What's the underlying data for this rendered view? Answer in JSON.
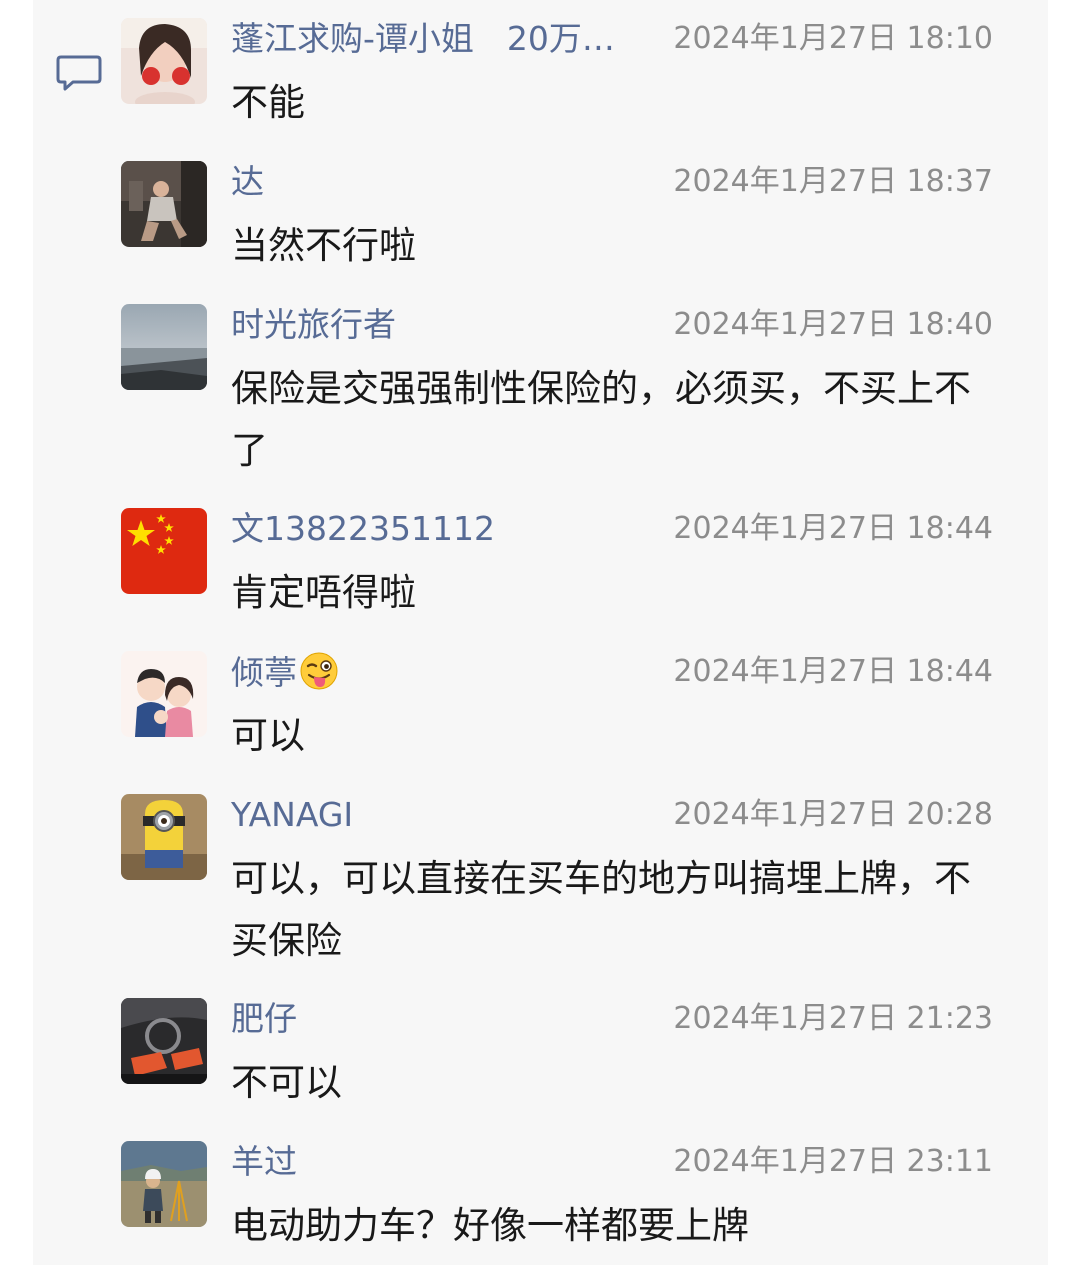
{
  "comments": [
    {
      "name": "蓬江求购-谭小姐　20万…",
      "time": "2024年1月27日 18:10",
      "text": "不能",
      "avatar_icon": "photo-avatar"
    },
    {
      "name": "达",
      "time": "2024年1月27日 18:37",
      "text": "当然不行啦",
      "avatar_icon": "photo-avatar"
    },
    {
      "name": "时光旅行者",
      "time": "2024年1月27日 18:40",
      "text": "保险是交强强制性保险的，必须买，不买上不了",
      "avatar_icon": "landscape-avatar"
    },
    {
      "name": "文13822351112",
      "time": "2024年1月27日 18:44",
      "text": "肯定唔得啦",
      "avatar_icon": "flag-avatar"
    },
    {
      "name": "倾葶",
      "time": "2024年1月27日 18:44",
      "text": "可以",
      "avatar_icon": "cartoon-avatar",
      "emoji": "winking-tongue-emoji"
    },
    {
      "name": "YANAGI",
      "time": "2024年1月27日 20:28",
      "text": "可以，可以直接在买车的地方叫搞埋上牌，不买保险",
      "avatar_icon": "minion-avatar"
    },
    {
      "name": "肥仔",
      "time": "2024年1月27日 21:23",
      "text": "不可以",
      "avatar_icon": "car-interior-avatar"
    },
    {
      "name": "羊过",
      "time": "2024年1月27日 23:11",
      "text": "电动助力车？好像一样都要上牌",
      "avatar_icon": "worker-avatar"
    }
  ],
  "icons": {
    "comment": "comment-icon"
  },
  "colors": {
    "name": "#576b95",
    "time": "#8c8c8c",
    "text": "#191919",
    "panel": "#f7f7f7"
  }
}
